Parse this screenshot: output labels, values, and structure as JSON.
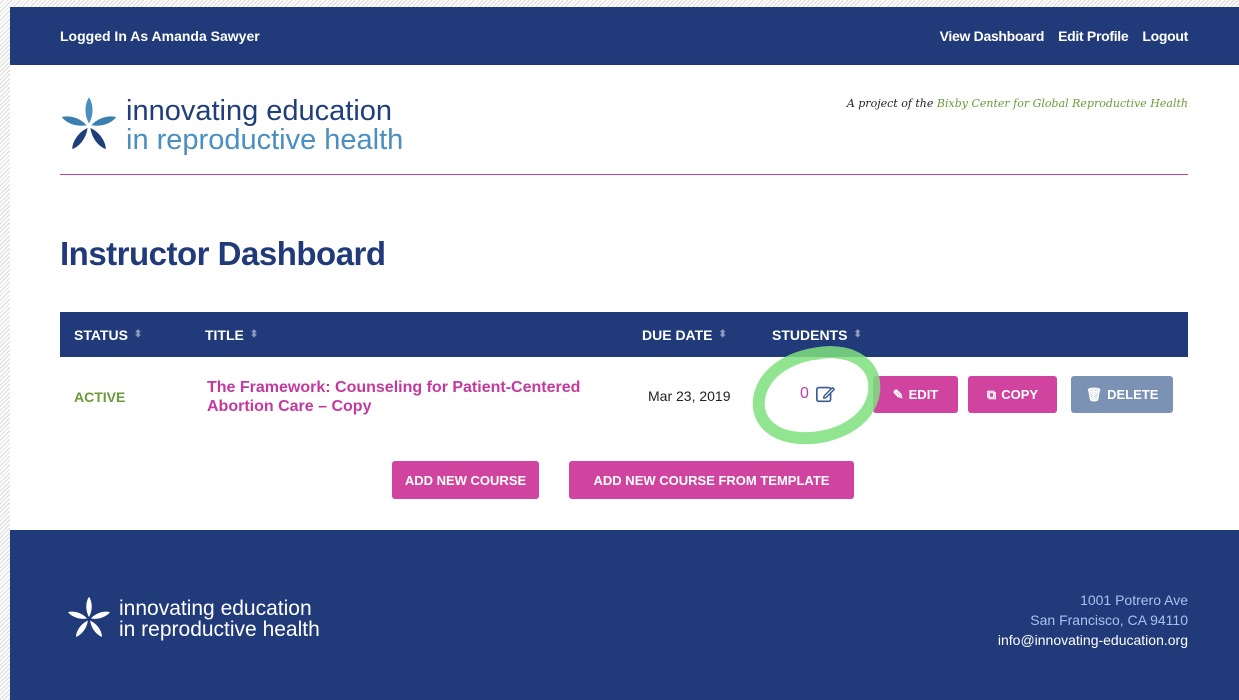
{
  "topbar": {
    "logged_prefix": "Logged In As",
    "user_name": "Amanda Sawyer",
    "nav": [
      "View Dashboard",
      "Edit Profile",
      "Logout"
    ]
  },
  "header": {
    "logo_line1": "innovating education",
    "logo_line2": "in reproductive health",
    "project_prefix": "A project of the",
    "project_link": "Bixby Center for Global Reproductive Health"
  },
  "page_title": "Instructor Dashboard",
  "table": {
    "headers": {
      "status": "STATUS",
      "title": "TITLE",
      "due_date": "DUE DATE",
      "students": "STUDENTS"
    },
    "rows": [
      {
        "status": "ACTIVE",
        "title": "The Framework: Counseling for Patient-Centered Abortion Care – Copy",
        "due_date": "Mar 23, 2019",
        "students": "0",
        "edit_label": "EDIT",
        "copy_label": "COPY",
        "delete_label": "DELETE"
      }
    ]
  },
  "actions": {
    "add_new": "ADD NEW COURSE",
    "add_from_template": "ADD NEW COURSE FROM TEMPLATE"
  },
  "footer": {
    "logo_line1": "innovating education",
    "logo_line2": "in reproductive health",
    "address_line1": "1001 Potrero Ave",
    "address_line2": "San Francisco, CA 94110",
    "email": "info@innovating-education.org"
  },
  "colors": {
    "navy": "#213a7a",
    "pink": "#d0449f",
    "green": "#6a9b3a",
    "gray_button": "#7c92b4"
  }
}
